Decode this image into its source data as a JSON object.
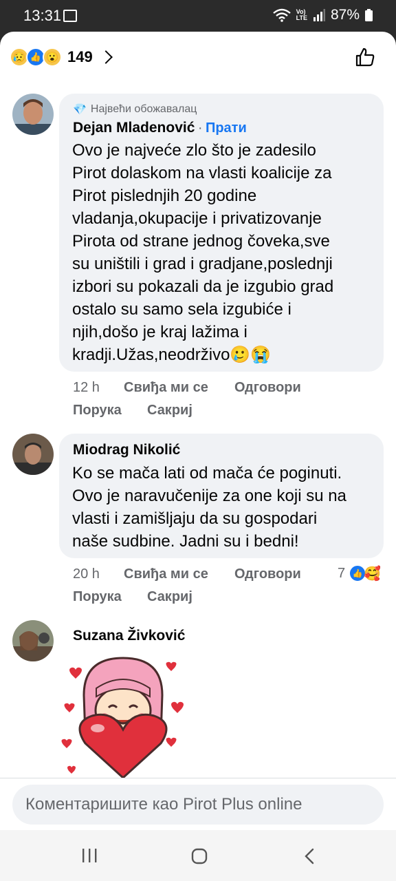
{
  "status": {
    "time": "13:31",
    "battery": "87%"
  },
  "reactions": {
    "count": "149"
  },
  "comments": [
    {
      "badge": "Највећи обожавалац",
      "author": "Dejan Mladenović",
      "follow": "Прати",
      "lines": [
        "Ovo je najveće zlo što je zadesilo",
        "Pirot dolaskom na vlasti koalicije za",
        "Pirot pislednjih 20 godine",
        "vladanja,okupacije i privatizovanje",
        "Pirota od strane jednog čoveka,sve",
        "su uništili i grad i gradjane,poslednji",
        "izbori su pokazali da je izgubio grad",
        "ostalo su samo sela izgubiće i",
        "njih,došo je kraj lažima i",
        "kradji.Užas,neodrživo🥲😭"
      ],
      "time": "12 h",
      "like": "Свиђа ми се",
      "reply": "Одговори",
      "message": "Порука",
      "hide": "Сакриј"
    },
    {
      "author": "Miodrag Nikolić",
      "lines": [
        "Ko se mača lati od mača će poginuti.",
        "Ovo je naravučenije za one koji su na",
        "vlasti i zamišljaju da su gospodari",
        "naše sudbine. Jadni su i bedni!"
      ],
      "time": "20 h",
      "like": "Свиђа ми се",
      "reply": "Одговори",
      "message": "Порука",
      "hide": "Сакриј",
      "reaction_count": "7"
    },
    {
      "author": "Suzana Živković"
    }
  ],
  "input": {
    "placeholder": "Коментаришите као Pirot Plus online"
  },
  "colors": {
    "accent": "#1877f2",
    "bubble": "#f0f2f5",
    "secondary": "#65676b"
  }
}
